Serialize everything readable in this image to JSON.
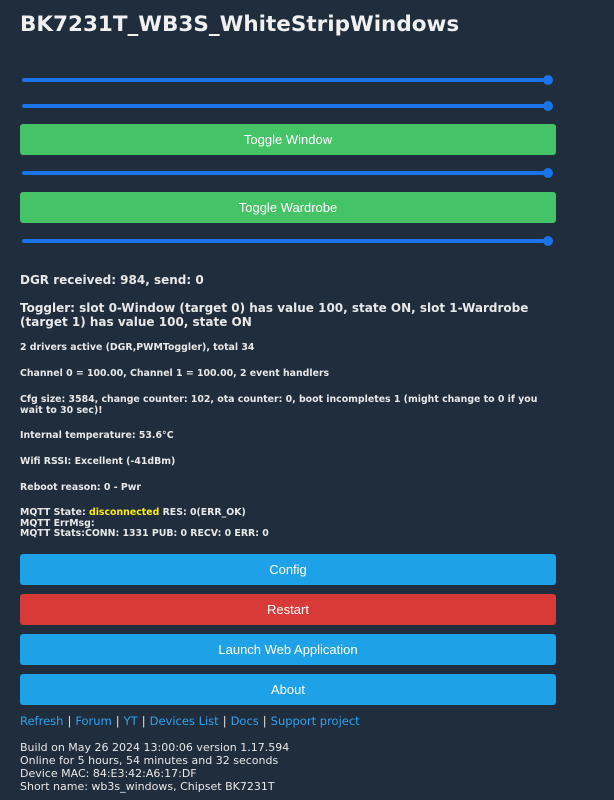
{
  "title": "BK7231T_WB3S_WhiteStripWindows",
  "sliders": [
    {
      "name": "slider-1",
      "value_percent": 100
    },
    {
      "name": "slider-2",
      "value_percent": 100
    },
    {
      "name": "slider-3",
      "value_percent": 100
    },
    {
      "name": "slider-4",
      "value_percent": 100
    }
  ],
  "toggle_buttons": {
    "window": "Toggle Window",
    "wardrobe": "Toggle Wardrobe"
  },
  "status": {
    "dgr": "DGR received: 984, send: 0",
    "toggler": "Toggler: slot 0-Window (target 0) has value 100, state ON, slot 1-Wardrobe (target 1) has value 100, state ON",
    "drivers": "2 drivers active (DGR,PWMToggler), total 34",
    "channels": "Channel 0 = 100.00, Channel 1 = 100.00, 2 event handlers",
    "cfg": "Cfg size: 3584, change counter: 102, ota counter: 0, boot incompletes 1 (might change to 0 if you wait to 30 sec)!",
    "temperature": "Internal temperature: 53.6°C",
    "wifi": "Wifi RSSI: Excellent (-41dBm)",
    "reboot": "Reboot reason: 0 - Pwr",
    "mqtt_state_label": "MQTT State: ",
    "mqtt_state_value": "disconnected",
    "mqtt_res": " RES: 0(ERR_OK)",
    "mqtt_errmsg": "MQTT ErrMsg:",
    "mqtt_stats": "MQTT Stats:CONN: 1331 PUB: 0 RECV: 0 ERR: 0"
  },
  "buttons": {
    "config": "Config",
    "restart": "Restart",
    "launch": "Launch Web Application",
    "about": "About"
  },
  "links": {
    "refresh": "Refresh",
    "forum": "Forum",
    "yt": "YT",
    "devices": "Devices List",
    "docs": "Docs",
    "support": "Support project",
    "separator": "|"
  },
  "footer": {
    "build": "Build on May 26 2024 13:00:06 version 1.17.594",
    "online": "Online for 5 hours, 54 minutes and 32 seconds",
    "mac": "Device MAC: 84:E3:42:A6:17:DF",
    "shortname": "Short name: wb3s_windows, Chipset BK7231T"
  },
  "colors": {
    "background": "#1f2d3c",
    "slider": "#1a73e8",
    "toggle_green": "#45c367",
    "button_blue": "#1ea1e7",
    "restart_red": "#d83939",
    "link": "#2ea3f2",
    "mqtt_disconnected": "#ffee00"
  }
}
